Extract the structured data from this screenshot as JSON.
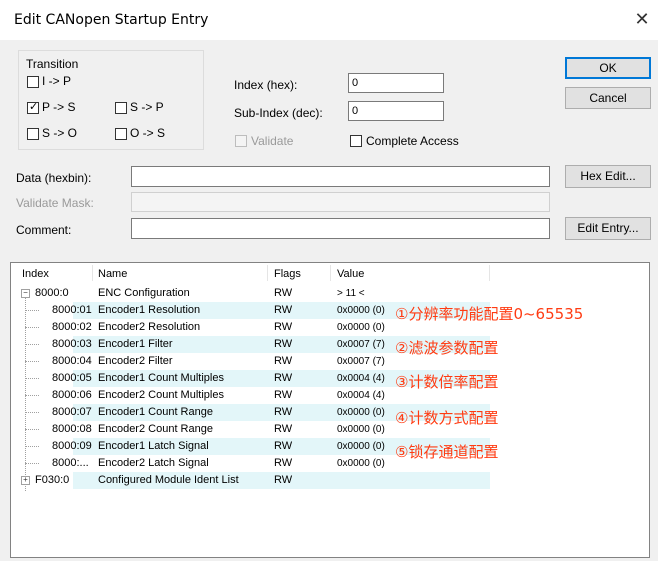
{
  "window": {
    "title": "Edit CANopen Startup Entry",
    "close_glyph": "✕"
  },
  "transition": {
    "label": "Transition",
    "i_p": {
      "label": "I -> P",
      "checked": false
    },
    "p_s": {
      "label": "P -> S",
      "checked": true
    },
    "s_p": {
      "label": "S -> P",
      "checked": false
    },
    "s_o": {
      "label": "S -> O",
      "checked": false
    },
    "o_s": {
      "label": "O -> S",
      "checked": false
    }
  },
  "index": {
    "label": "Index (hex):",
    "value": "0"
  },
  "subindex": {
    "label": "Sub-Index (dec):",
    "value": "0"
  },
  "validate": {
    "label": "Validate"
  },
  "complete_access": {
    "label": "Complete Access"
  },
  "buttons": {
    "ok": "OK",
    "cancel": "Cancel",
    "hex_edit": "Hex Edit...",
    "edit_entry": "Edit Entry..."
  },
  "data": {
    "label": "Data (hexbin):",
    "value": ""
  },
  "validate_mask": {
    "label": "Validate Mask:",
    "value": ""
  },
  "comment": {
    "label": "Comment:",
    "value": ""
  },
  "table": {
    "columns": [
      "Index",
      "Name",
      "Flags",
      "Value"
    ],
    "rows": [
      {
        "index": "8000:0",
        "name": "ENC Configuration",
        "flags": "RW",
        "value": "> 11 <",
        "level": 0,
        "expander": "−",
        "highlight": false
      },
      {
        "index": "8000:01",
        "name": "Encoder1 Resolution",
        "flags": "RW",
        "value": "0x0000 (0)",
        "level": 1,
        "highlight": true
      },
      {
        "index": "8000:02",
        "name": "Encoder2 Resolution",
        "flags": "RW",
        "value": "0x0000 (0)",
        "level": 1,
        "highlight": false
      },
      {
        "index": "8000:03",
        "name": "Encoder1 Filter",
        "flags": "RW",
        "value": "0x0007 (7)",
        "level": 1,
        "highlight": true
      },
      {
        "index": "8000:04",
        "name": "Encoder2 Filter",
        "flags": "RW",
        "value": "0x0007 (7)",
        "level": 1,
        "highlight": false
      },
      {
        "index": "8000:05",
        "name": "Encoder1 Count Multiples",
        "flags": "RW",
        "value": "0x0004 (4)",
        "level": 1,
        "highlight": true
      },
      {
        "index": "8000:06",
        "name": "Encoder2 Count Multiples",
        "flags": "RW",
        "value": "0x0004 (4)",
        "level": 1,
        "highlight": false
      },
      {
        "index": "8000:07",
        "name": "Encoder1 Count Range",
        "flags": "RW",
        "value": "0x0000 (0)",
        "level": 1,
        "highlight": true
      },
      {
        "index": "8000:08",
        "name": "Encoder2 Count Range",
        "flags": "RW",
        "value": "0x0000 (0)",
        "level": 1,
        "highlight": false
      },
      {
        "index": "8000:09",
        "name": "Encoder1 Latch Signal",
        "flags": "RW",
        "value": "0x0000 (0)",
        "level": 1,
        "highlight": true
      },
      {
        "index": "8000:...",
        "name": "Encoder2 Latch Signal",
        "flags": "RW",
        "value": "0x0000 (0)",
        "level": 1,
        "highlight": false
      },
      {
        "index": "F030:0",
        "name": "Configured Module Ident List",
        "flags": "RW",
        "value": "",
        "level": 0,
        "expander": "+",
        "highlight": true
      }
    ]
  },
  "annotations": [
    "①分辨率功能配置0~65535",
    "②滤波参数配置",
    "③计数倍率配置",
    "④计数方式配置",
    "⑤锁存通道配置"
  ],
  "colors": {
    "annotation": "#ff3b12",
    "row_highlight": "#e3f6f9",
    "default_button_border": "#0078d7"
  }
}
